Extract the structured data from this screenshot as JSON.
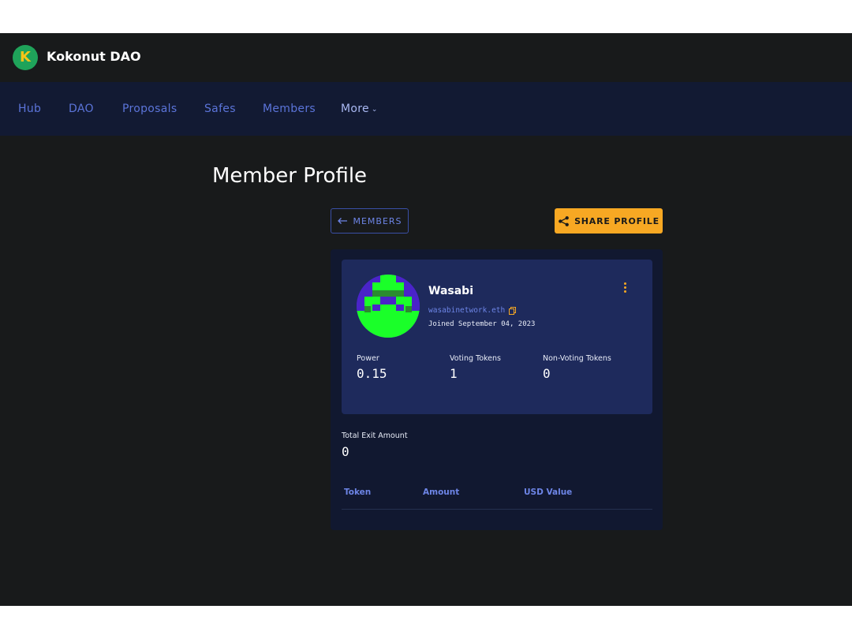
{
  "header": {
    "logo_letter": "K",
    "dao_name": "Kokonut DAO"
  },
  "nav": {
    "items": [
      {
        "label": "Hub"
      },
      {
        "label": "DAO"
      },
      {
        "label": "Proposals"
      },
      {
        "label": "Safes"
      },
      {
        "label": "Members"
      },
      {
        "label": "More"
      }
    ]
  },
  "page": {
    "title": "Member Profile"
  },
  "actions": {
    "back_label": "MEMBERS",
    "share_label": "SHARE PROFILE"
  },
  "profile": {
    "name": "Wasabi",
    "address": "wasabinetwork.eth",
    "joined": "Joined September 04, 2023",
    "stats": [
      {
        "label": "Power",
        "value": "0.15"
      },
      {
        "label": "Voting Tokens",
        "value": "1"
      },
      {
        "label": "Non-Voting Tokens",
        "value": "0"
      }
    ]
  },
  "exit": {
    "label": "Total Exit Amount",
    "value": "0"
  },
  "table": {
    "columns": [
      "Token",
      "Amount",
      "USD Value"
    ]
  },
  "colors": {
    "background": "#181a1b",
    "navbar": "#121a33",
    "card": "#1e2a5c",
    "accent": "#6d85e6",
    "share_button": "#f7a823",
    "avatar_green": "#1aff29",
    "avatar_purple": "#4a24c9"
  },
  "icons": [
    "logo-icon",
    "chevron-down-icon",
    "arrow-left-icon",
    "share-icon",
    "copy-icon",
    "kebab-menu-icon"
  ]
}
